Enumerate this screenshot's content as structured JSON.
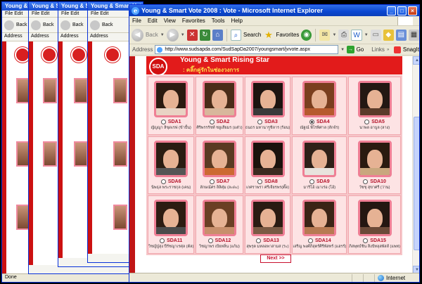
{
  "window": {
    "title": "Young & Smart Vote 2008 : Vote - Microsoft Internet Explorer",
    "controls": {
      "minimize": "_",
      "maximize": "□",
      "close": "×"
    }
  },
  "menu": [
    "File",
    "Edit",
    "View",
    "Favorites",
    "Tools",
    "Help"
  ],
  "toolbar": {
    "back": "Back",
    "search": "Search",
    "favorites": "Favorites"
  },
  "address": {
    "label": "Address",
    "url": "http://www.sudsapda.com/SudSapDa2007/youngsmart/jvvote.aspx",
    "go": "Go",
    "links": "Links",
    "snagit": "SnagIt"
  },
  "banner": {
    "logo": "SDA",
    "title": "Young & Smart Rising Star",
    "subtitle": ": คลิ๊กคู่รักในช่องวงการ"
  },
  "candidates": [
    {
      "code": "SDA1",
      "name": "ญัญญา ลิขุดเรฟ (ข้าปั้น)",
      "selected": false,
      "hair": "#2b1a10",
      "shirt": "#e9d3c4"
    },
    {
      "code": "SDA2",
      "name": "ศิริพรรรัชท์ ชยูเสียมร (แต๋ว)",
      "selected": false,
      "hair": "#4a2c18",
      "shirt": "#d8b79c"
    },
    {
      "code": "SDA3",
      "name": "ธนธร มหานารฺูชิลาร (ร้อน)",
      "selected": false,
      "hair": "#1c1410",
      "shirt": "#3a3a3a"
    },
    {
      "code": "SDA4",
      "name": "ณัฐณ์ พิไรพิศาล (ลักจ์ร)",
      "selected": true,
      "hair": "#7a3e1e",
      "shirt": "#b65a2e"
    },
    {
      "code": "SDA5",
      "name": "นาพล อาบูล (ลาง)",
      "selected": false,
      "hair": "#231813",
      "shirt": "#5b3b2a"
    },
    {
      "code": "SDA6",
      "name": "นิพธุล พระราชกุล (เคน)",
      "selected": false,
      "hair": "#2a1c12",
      "shirt": "#555555"
    },
    {
      "code": "SDA7",
      "name": "ลักษณ์ศร ลิลิศุ่ม (ละดะ)",
      "selected": false,
      "hair": "#5a3a22",
      "shirt": "#cc6a32"
    },
    {
      "code": "SDA8",
      "name": "เกศราพรา ศรีเจียรพร(ตั๊ด)",
      "selected": false,
      "hair": "#1a120c",
      "shirt": "#3c2a20"
    },
    {
      "code": "SDA9",
      "name": "มาริโอ้ เมาเร่อ (โอ้)",
      "selected": false,
      "hair": "#2e2018",
      "shirt": "#e8e3dd"
    },
    {
      "code": "SDA10",
      "name": "วัชชุ สุขาศรี (ว่าน)",
      "selected": false,
      "hair": "#2a1a10",
      "shirt": "#c9a77e"
    },
    {
      "code": "SDA11",
      "name": "วิชญ์ปู่สุง ปีรัชญาเรศุล (ต้ล)",
      "selected": false,
      "hair": "#2d1c12",
      "shirt": "#4b4b4b"
    },
    {
      "code": "SDA12",
      "name": "วิชญาพร เบียทลิ่น (แก้ม)",
      "selected": false,
      "hair": "#6a3f24",
      "shirt": "#c88f6c"
    },
    {
      "code": "SDA13",
      "name": "สุพรุต มหลอพาสามส (ระ)",
      "selected": false,
      "hair": "#2a1b12",
      "shirt": "#7a5a44"
    },
    {
      "code": "SDA14",
      "name": "เสริญ พงศ์ภิสุตร์ศิรีพัสทร์ (แฮรร์)",
      "selected": false,
      "hair": "#3b2416",
      "shirt": "#b77a52"
    },
    {
      "code": "SDA15",
      "name": "ภิสพุทธ์ชิน สิงปัทลุสพัสส์ (แพท)",
      "selected": false,
      "hair": "#241711",
      "shirt": "#6b4a38"
    }
  ],
  "next_button": "Next >>",
  "status": {
    "left": "",
    "zone": "Internet"
  },
  "back_windows": {
    "title": "Young & Smart Vote 2008 : Vote - Microsoft Internet Explorer",
    "menu": "File Edit",
    "back": "Back",
    "address": "Address",
    "status": "Done"
  }
}
